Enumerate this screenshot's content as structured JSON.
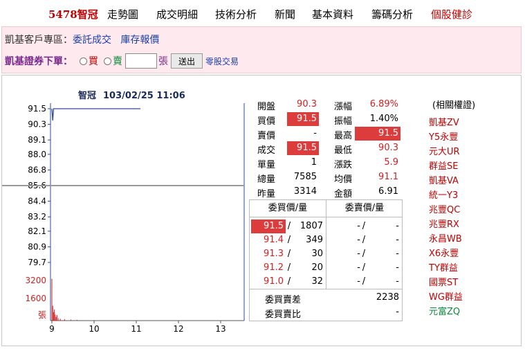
{
  "nav": {
    "items": [
      "5478智冠",
      "走勢圖",
      "成交明細",
      "技術分析",
      "新聞",
      "基本資料",
      "籌碼分析",
      "個股健診"
    ]
  },
  "client_zone": {
    "label": "凱基客戶專區：",
    "links": [
      "委託成交",
      "庫存報價"
    ]
  },
  "order": {
    "label": "凱基證券下單：",
    "buy": "買",
    "sell": "賣",
    "unit": "張",
    "send_button": "送出",
    "odd_lot": "零股交易",
    "quantity_value": ""
  },
  "chart": {
    "stock_name": "智冠",
    "datetime": "103/02/25 11:06",
    "price_ticks": [
      "91.5",
      "90.3",
      "89.1",
      "88.0",
      "86.8",
      "85.6",
      "84.4",
      "83.2",
      "82.1",
      "80.9",
      "79.7"
    ],
    "volume_ticks": [
      "3200",
      "1600",
      "張"
    ],
    "time_ticks": [
      "9",
      "10",
      "11",
      "12",
      "13"
    ]
  },
  "chart_data": {
    "type": "line",
    "title": "智冠 103/02/25 11:06",
    "xlabel": "",
    "ylabel": "",
    "ylim": [
      79.7,
      91.5
    ],
    "reference_price": 85.6,
    "x_range": [
      9,
      13.5
    ],
    "series": [
      {
        "x": [
          9.0,
          9.02,
          9.04,
          9.06,
          9.1,
          9.2,
          9.5,
          10.0,
          10.5,
          11.0,
          11.1
        ],
        "values": [
          91.5,
          90.6,
          91.5,
          91.5,
          91.5,
          91.5,
          91.5,
          91.5,
          91.5,
          91.5,
          91.5
        ]
      }
    ],
    "volume": {
      "ylim": [
        0,
        3600
      ],
      "x": [
        9.0,
        9.02,
        9.04,
        9.06,
        9.08,
        9.1,
        9.12,
        9.15,
        9.2,
        9.3,
        9.45,
        9.6
      ],
      "values": [
        3400,
        1200,
        700,
        900,
        500,
        300,
        450,
        200,
        150,
        120,
        80,
        60
      ]
    }
  },
  "quote": {
    "left": [
      {
        "label": "開盤",
        "value": "90.3",
        "color": "red",
        "highlight": false
      },
      {
        "label": "買價",
        "value": "91.5",
        "color": "white",
        "highlight": true
      },
      {
        "label": "賣價",
        "value": "-",
        "color": "black",
        "highlight": false
      },
      {
        "label": "成交",
        "value": "91.5",
        "color": "white",
        "highlight": true
      },
      {
        "label": "單量",
        "value": "1",
        "color": "black",
        "highlight": false
      },
      {
        "label": "總量",
        "value": "7585",
        "color": "black",
        "highlight": false
      },
      {
        "label": "昨量",
        "value": "3314",
        "color": "black",
        "highlight": false
      }
    ],
    "right": [
      {
        "label": "漲幅",
        "value": "6.89%",
        "color": "red",
        "highlight": false
      },
      {
        "label": "振幅",
        "value": "1.40%",
        "color": "black",
        "highlight": false
      },
      {
        "label": "最高",
        "value": "91.5",
        "color": "white",
        "highlight": true
      },
      {
        "label": "最低",
        "value": "90.3",
        "color": "red",
        "highlight": false
      },
      {
        "label": "漲跌",
        "value": "5.9",
        "color": "red",
        "highlight": false
      },
      {
        "label": "均價",
        "value": "91.1",
        "color": "red",
        "highlight": false
      },
      {
        "label": "金額",
        "value": "6.91",
        "color": "black",
        "highlight": false
      }
    ]
  },
  "book": {
    "buy_header": "委買價/量",
    "sell_header": "委賣價/量",
    "rows": [
      {
        "bid": "91.5",
        "bid_qty": "1807",
        "ask": "-",
        "ask_qty": "-",
        "highlight": true
      },
      {
        "bid": "91.4",
        "bid_qty": "349",
        "ask": "-",
        "ask_qty": "-",
        "highlight": false
      },
      {
        "bid": "91.3",
        "bid_qty": "30",
        "ask": "-",
        "ask_qty": "-",
        "highlight": false
      },
      {
        "bid": "91.2",
        "bid_qty": "20",
        "ask": "-",
        "ask_qty": "-",
        "highlight": false
      },
      {
        "bid": "91.0",
        "bid_qty": "32",
        "ask": "-",
        "ask_qty": "-",
        "highlight": false
      }
    ],
    "diff_label": "委買賣差",
    "diff_value": "2238",
    "ratio_label": "委買賣比",
    "ratio_value": "-"
  },
  "warrants": {
    "title": "(相關權證)",
    "items": [
      {
        "name": "凱基ZV",
        "color": "#c00000"
      },
      {
        "name": "Y5永豐",
        "color": "#c00000"
      },
      {
        "name": "元大UR",
        "color": "#c00000"
      },
      {
        "name": "群益SE",
        "color": "#c00000"
      },
      {
        "name": "凱基VA",
        "color": "#c00000"
      },
      {
        "name": "統一Y3",
        "color": "#c00000"
      },
      {
        "name": "兆豐QC",
        "color": "#c00000"
      },
      {
        "name": "兆豐RX",
        "color": "#c00000"
      },
      {
        "name": "永昌WB",
        "color": "#c00000"
      },
      {
        "name": "X6永豐",
        "color": "#c00000"
      },
      {
        "name": "TY群益",
        "color": "#c00000"
      },
      {
        "name": "國票ST",
        "color": "#c00000"
      },
      {
        "name": "WG群益",
        "color": "#c00000"
      },
      {
        "name": "元富ZQ",
        "color": "#0a8a3a"
      }
    ]
  },
  "colors": {
    "up": "#d02020",
    "highlight_bg": "#dd3c3c",
    "line": "#2b4a9a",
    "volume": "#d02020",
    "reference_line": "#999999"
  }
}
